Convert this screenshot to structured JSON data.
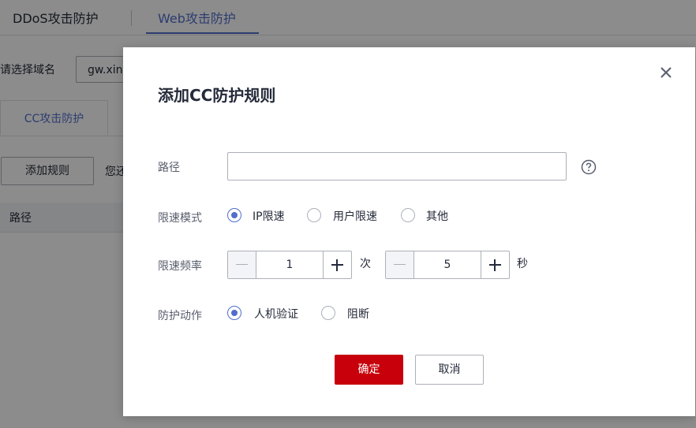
{
  "top_tabs": {
    "ddos": "DDoS攻击防护",
    "web": "Web攻击防护"
  },
  "domain": {
    "label": "请选择域名",
    "value": "gw.xin"
  },
  "sub_tabs": {
    "cc": "CC攻击防护"
  },
  "toolbar": {
    "add_rule": "添加规则",
    "hint": "您还"
  },
  "table": {
    "header_path": "路径"
  },
  "dialog": {
    "title": "添加CC防护规则",
    "path_label": "路径",
    "path_value": "",
    "mode_label": "限速模式",
    "mode_options": [
      "IP限速",
      "用户限速",
      "其他"
    ],
    "mode_selected": "IP限速",
    "rate_label": "限速频率",
    "rate_count": "1",
    "rate_count_unit": "次",
    "rate_seconds": "5",
    "rate_seconds_unit": "秒",
    "action_label": "防护动作",
    "action_options": [
      "人机验证",
      "阻断"
    ],
    "action_selected": "人机验证",
    "ok": "确定",
    "cancel": "取消"
  },
  "colors": {
    "accent": "#526ecc",
    "primary_button": "#c7000b"
  }
}
